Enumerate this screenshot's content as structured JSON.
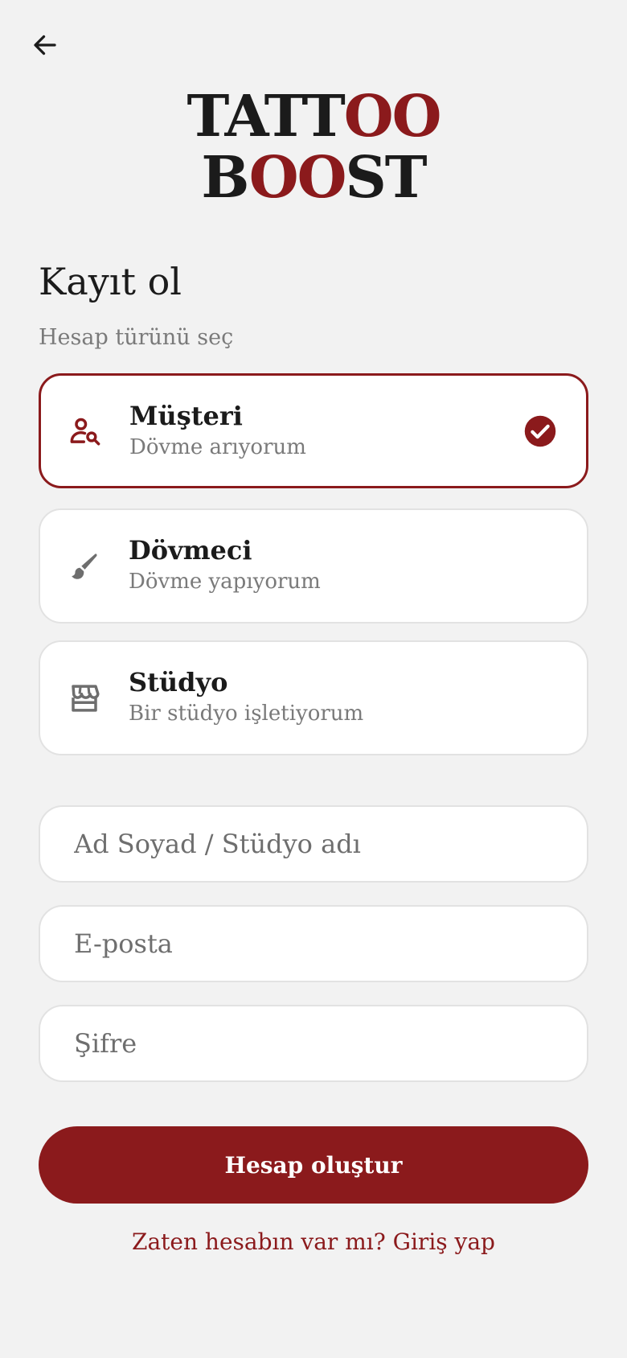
{
  "header": {
    "back_icon": "arrow-left-icon"
  },
  "logo": {
    "line1_dark": "TATT",
    "line1_accent": "OO",
    "line2_dark_start": "B",
    "line2_accent": "OO",
    "line2_dark_end": "ST"
  },
  "page": {
    "title": "Kayıt ol",
    "account_type_label": "Hesap türünü seç"
  },
  "account_types": [
    {
      "title": "Müşteri",
      "subtitle": "Dövme arıyorum",
      "icon": "person-search-icon",
      "selected": true
    },
    {
      "title": "Dövmeci",
      "subtitle": "Dövme yapıyorum",
      "icon": "brush-icon",
      "selected": false
    },
    {
      "title": "Stüdyo",
      "subtitle": "Bir stüdyo işletiyorum",
      "icon": "storefront-icon",
      "selected": false
    }
  ],
  "form": {
    "name_placeholder": "Ad Soyad / Stüdyo adı",
    "name_value": "",
    "email_placeholder": "E-posta",
    "email_value": "",
    "password_placeholder": "Şifre",
    "password_value": ""
  },
  "actions": {
    "submit_label": "Hesap oluştur",
    "login_link": "Zaten hesabın var mı? Giriş yap"
  },
  "colors": {
    "accent": "#8b1a1c",
    "background": "#f2f2f2",
    "card": "#ffffff",
    "muted_text": "#7a7a7a"
  }
}
